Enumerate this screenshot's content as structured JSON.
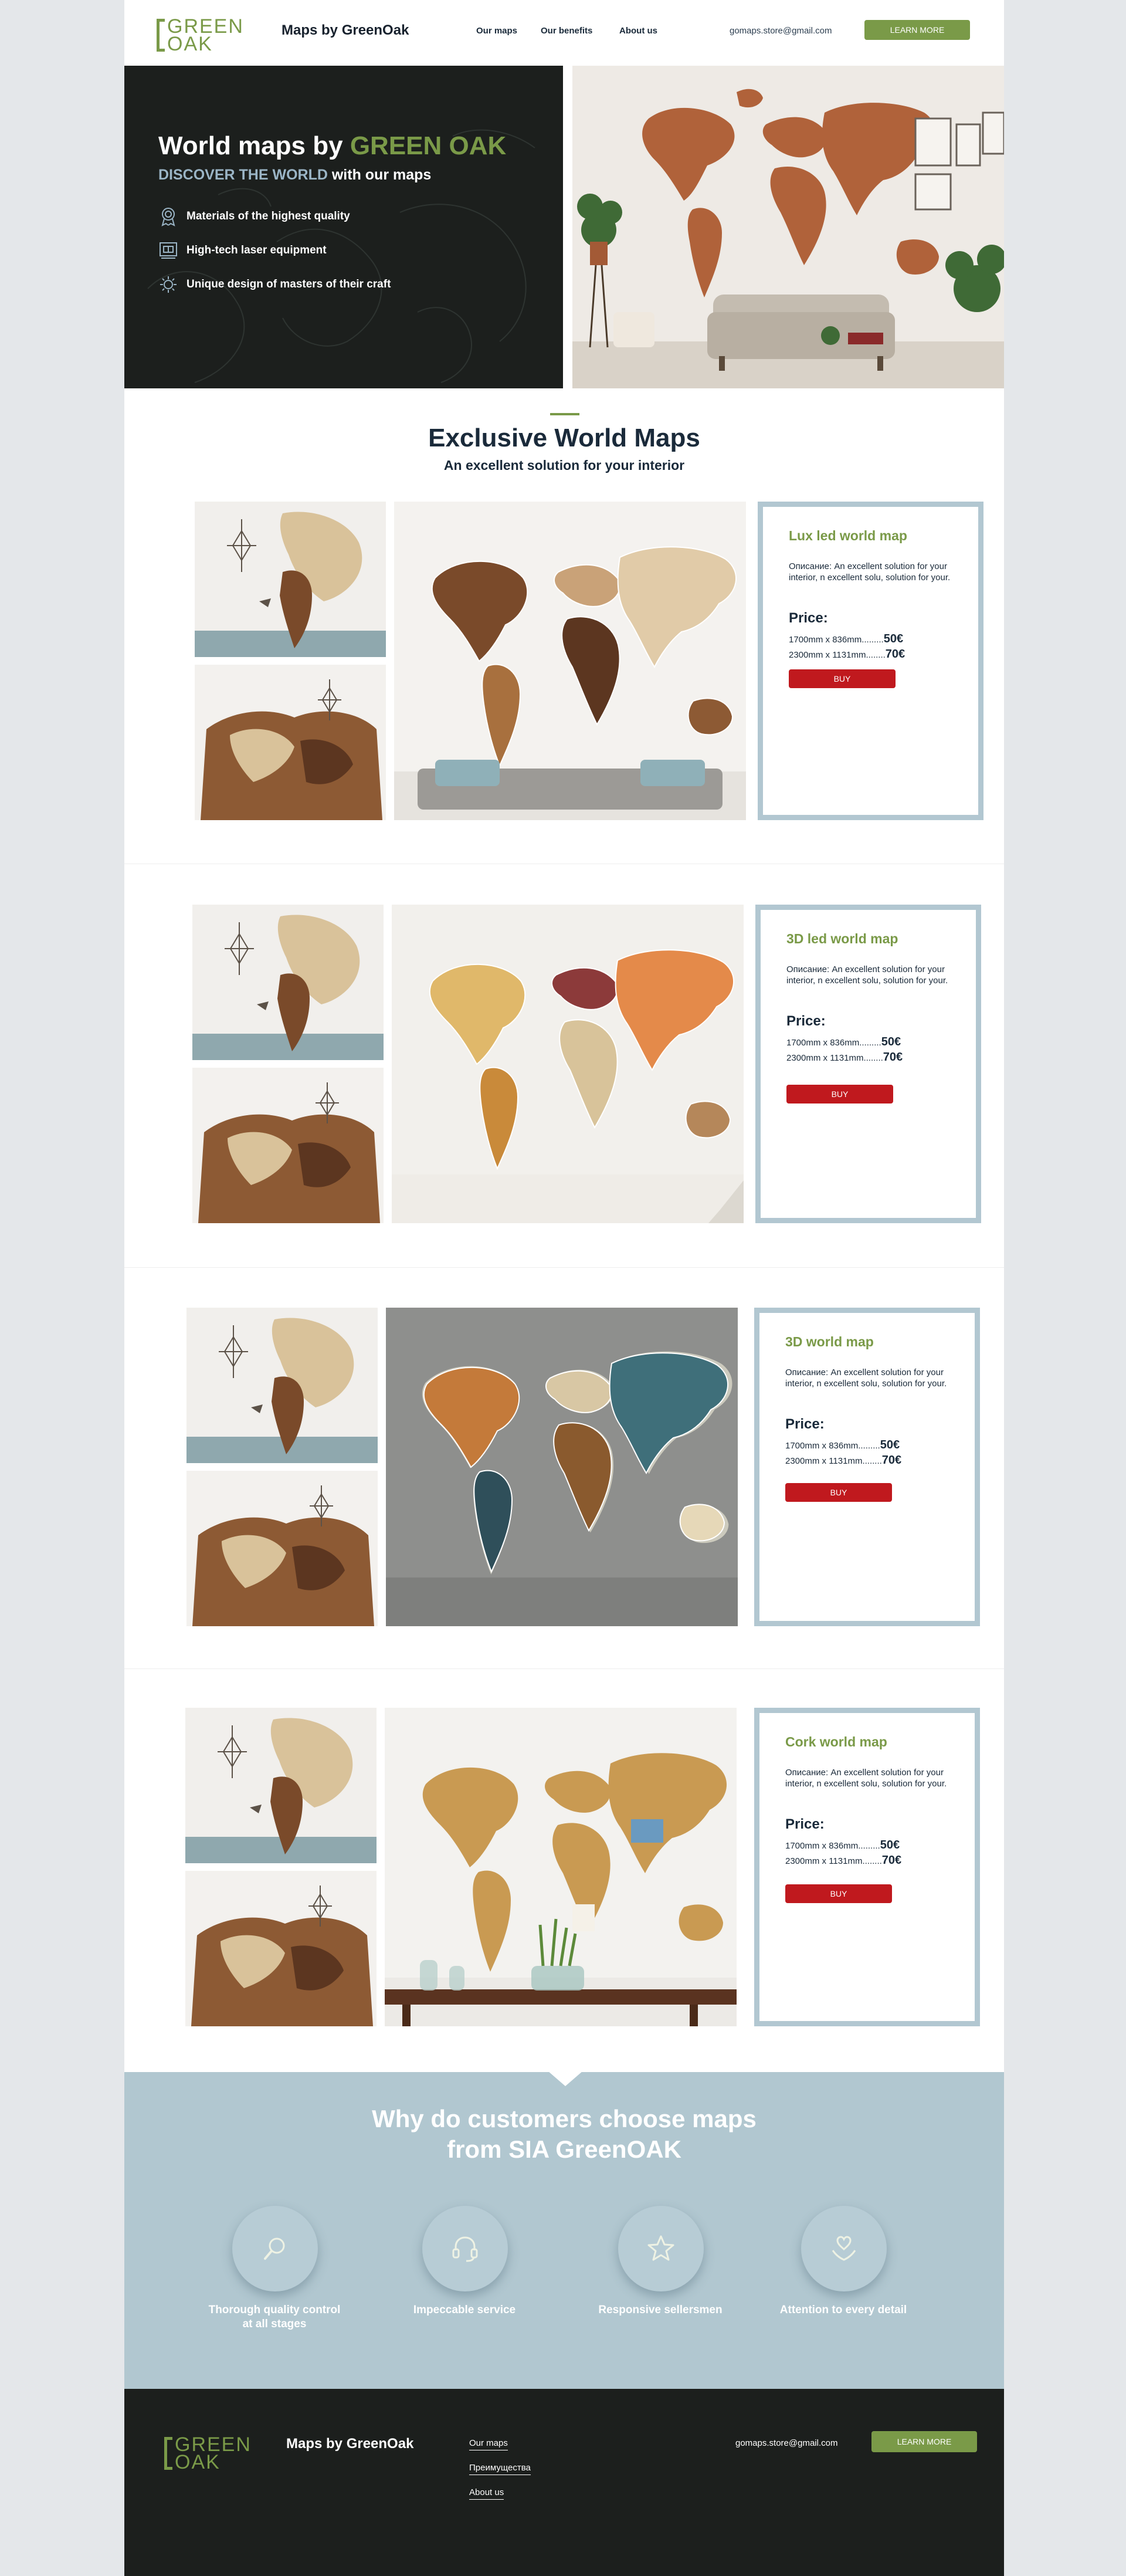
{
  "header": {
    "logo_line1": "GREEN",
    "logo_line2": "OAK",
    "brand": "Maps by GreenOak",
    "nav": [
      "Our maps",
      "Our benefits",
      "About us"
    ],
    "email": "gomaps.store@gmail.com",
    "cta": "LEARN MORE"
  },
  "hero": {
    "title_part1": "World maps by ",
    "title_part2": "GREEN OAK",
    "subtitle_part1": "DISCOVER THE WORLD",
    "subtitle_part2": " with our maps",
    "features": [
      {
        "icon": "award-icon",
        "text": "Materials of the highest quality"
      },
      {
        "icon": "laser-machine-icon",
        "text": "High-tech laser equipment"
      },
      {
        "icon": "design-icon",
        "text": "Unique design of masters of their craft"
      }
    ]
  },
  "products_section": {
    "title": "Exclusive World Maps",
    "subtitle": "An excellent solution for your interior"
  },
  "products": [
    {
      "name": "Lux led world map",
      "description": "Описание: An excellent solution for your interior, n excellent solu, solution for your.",
      "price_label": "Price:",
      "price1_size": "1700mm x 836mm.........",
      "price1_value": "50€",
      "price2_size": "2300mm x 1131mm........",
      "price2_value": "70€",
      "buy": "BUY",
      "map_style": "wood"
    },
    {
      "name": "3D led world map",
      "description": "Описание: An excellent solution for your interior, n excellent solu, solution for your.",
      "price_label": "Price:",
      "price1_size": "1700mm x 836mm.........",
      "price1_value": "50€",
      "price2_size": "2300mm x 1131mm........",
      "price2_value": "70€",
      "buy": "BUY",
      "map_style": "light"
    },
    {
      "name": "3D world map",
      "description": "Описание: An excellent solution for your interior, n excellent solu, solution for your.",
      "price_label": "Price:",
      "price1_size": "1700mm x 836mm.........",
      "price1_value": "50€",
      "price2_size": "2300mm x 1131mm........",
      "price2_value": "70€",
      "buy": "BUY",
      "map_style": "glow"
    },
    {
      "name": "Cork world map",
      "description": "Описание: An excellent solution for your interior, n excellent solu, solution for your.",
      "price_label": "Price:",
      "price1_size": "1700mm x 836mm.........",
      "price1_value": "50€",
      "price2_size": "2300mm x 1131mm........",
      "price2_value": "70€",
      "buy": "BUY",
      "map_style": "cork"
    }
  ],
  "why": {
    "title_line1": "Why do customers choose maps",
    "title_line2": "from SIA GreenOAK",
    "items": [
      {
        "icon": "magnifier-icon",
        "label_line1": "Thorough quality control",
        "label_line2": "at all stages"
      },
      {
        "icon": "headset-icon",
        "label_line1": "Impeccable service",
        "label_line2": ""
      },
      {
        "icon": "star-icon",
        "label_line1": "Responsive sellersmen",
        "label_line2": ""
      },
      {
        "icon": "heart-hands-icon",
        "label_line1": "Attention to every detail",
        "label_line2": ""
      }
    ]
  },
  "footer": {
    "logo_line1": "GREEN",
    "logo_line2": "OAK",
    "brand": "Maps by GreenOak",
    "links": [
      "Our maps",
      "Преимущества",
      "About us"
    ],
    "email": "gomaps.store@gmail.com",
    "cta": "LEARN MORE"
  },
  "colors": {
    "accent_green": "#7a9a48",
    "buy_red": "#c0191e",
    "card_border": "#b2c7d1",
    "why_bg": "#b1c7d0",
    "dark_bg": "#1c1f1d"
  }
}
